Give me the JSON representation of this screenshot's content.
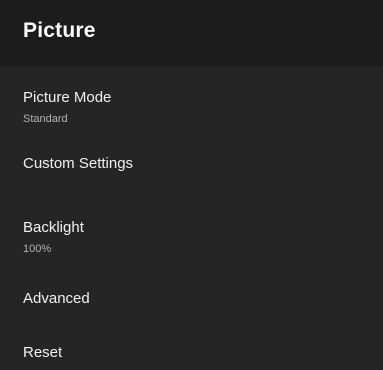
{
  "header": {
    "title": "Picture"
  },
  "menu": {
    "items": [
      {
        "label": "Picture Mode",
        "value": "Standard"
      },
      {
        "label": "Custom Settings"
      },
      {
        "label": "Backlight",
        "value": "100%"
      },
      {
        "label": "Advanced"
      },
      {
        "label": "Reset"
      }
    ]
  },
  "colors": {
    "header_background": "#1b1c1e",
    "panel_background": "#242527",
    "text_primary": "#f1f1f1",
    "text_secondary": "#b3b3b3"
  }
}
